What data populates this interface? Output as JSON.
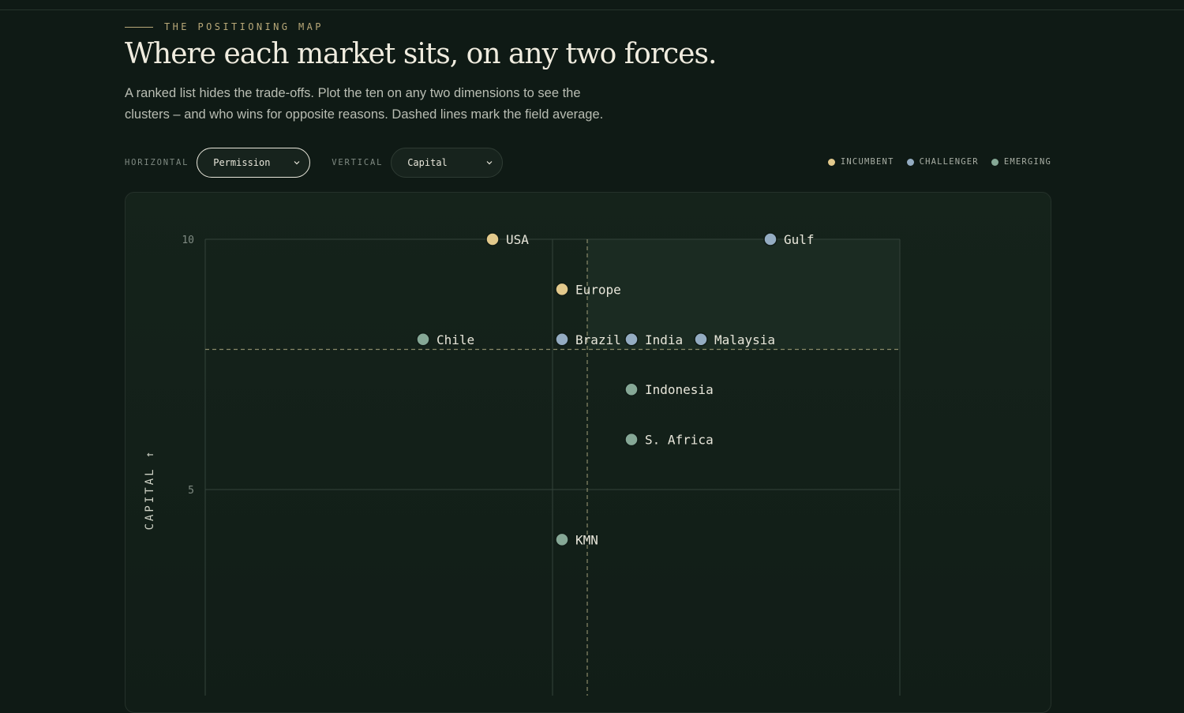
{
  "eyebrow": "THE POSITIONING MAP",
  "headline": "Where each market sits, on any two forces.",
  "lede": "A ranked list hides the trade-offs. Plot the ten on any two dimensions to see the clusters – and who wins for opposite reasons. Dashed lines mark the field average.",
  "controls": {
    "horizontal_label": "HORIZONTAL",
    "horizontal_value": "Permission",
    "vertical_label": "VERTICAL",
    "vertical_value": "Capital"
  },
  "legend": [
    {
      "label": "INCUMBENT",
      "color": "#e2c98c"
    },
    {
      "label": "CHALLENGER",
      "color": "#94acc2"
    },
    {
      "label": "EMERGING",
      "color": "#86a896"
    }
  ],
  "chart_data": {
    "type": "scatter",
    "ylabel": "CAPITAL ↑",
    "xlim": [
      0,
      10
    ],
    "ylim": [
      0,
      10
    ],
    "y_ticks": [
      5,
      10
    ],
    "average": {
      "x": 5.5,
      "y": 7.8
    },
    "points": [
      {
        "name": "USA",
        "x": 4,
        "y": 10,
        "group": "INCUMBENT"
      },
      {
        "name": "Gulf",
        "x": 8,
        "y": 10,
        "group": "CHALLENGER"
      },
      {
        "name": "Europe",
        "x": 5,
        "y": 9,
        "group": "INCUMBENT"
      },
      {
        "name": "Chile",
        "x": 3,
        "y": 8,
        "group": "EMERGING"
      },
      {
        "name": "Brazil",
        "x": 5,
        "y": 8,
        "group": "CHALLENGER"
      },
      {
        "name": "India",
        "x": 6,
        "y": 8,
        "group": "CHALLENGER"
      },
      {
        "name": "Malaysia",
        "x": 7,
        "y": 8,
        "group": "CHALLENGER"
      },
      {
        "name": "Indonesia",
        "x": 6,
        "y": 7,
        "group": "EMERGING"
      },
      {
        "name": "S. Africa",
        "x": 6,
        "y": 6,
        "group": "EMERGING"
      },
      {
        "name": "KMN",
        "x": 5,
        "y": 4,
        "group": "EMERGING"
      }
    ]
  }
}
